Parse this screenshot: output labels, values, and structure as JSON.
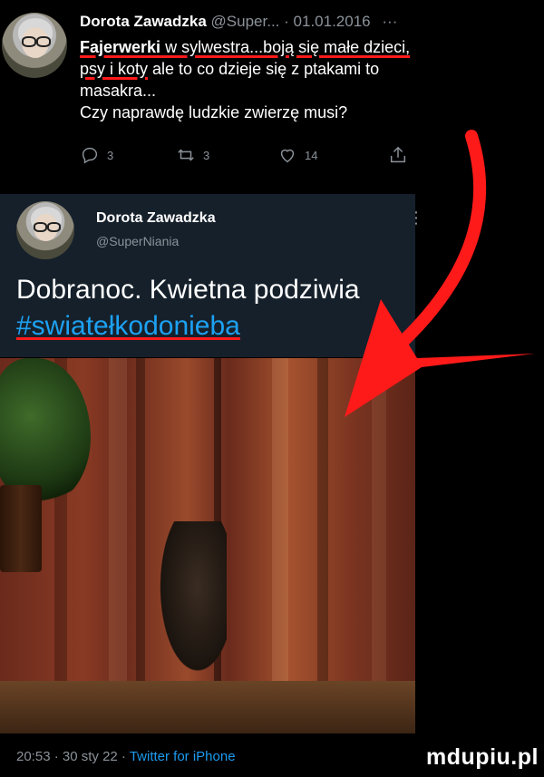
{
  "top_tweet": {
    "author": "Dorota Zawadzka",
    "handle": "@Super...",
    "sep": "·",
    "date": "01.01.2016",
    "more": "···",
    "line1_bold": "Fajerwerki",
    "line1_rest": " w sylwestra...boją się małe dzieci,",
    "line2_ul": "psy i koty",
    "line2_rest": " ale to co dzieje się z ptakami to",
    "line3": "masakra...",
    "line4": "Czy naprawdę ludzkie zwierzę musi?",
    "reply_count": "3",
    "retweet_count": "3",
    "like_count": "14"
  },
  "card": {
    "author": "Dorota Zawadzka",
    "handle": "@SuperNiania",
    "more": "⋮",
    "text_line1": "Dobranoc. Kwietna podziwia",
    "hashtag": "#swiatełkodonieba"
  },
  "footer": {
    "time": "20:53",
    "sep1": " · ",
    "date": "30 sty 22",
    "sep2": " · ",
    "source": "Twitter for iPhone"
  },
  "watermark": "mdupiu.pl",
  "colors": {
    "background": "#000000",
    "card_bg": "#15202b",
    "muted": "#8b9299",
    "link": "#1da1f2",
    "annotation_red": "#ff1a1a"
  }
}
